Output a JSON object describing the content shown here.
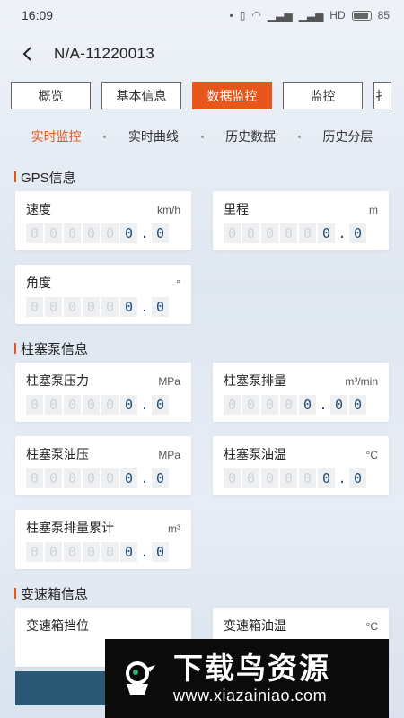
{
  "status_bar": {
    "time": "16:09",
    "network": "HD",
    "battery": "85"
  },
  "header": {
    "title": "N/A-11220013"
  },
  "tabs": [
    {
      "label": "概览",
      "active": false
    },
    {
      "label": "基本信息",
      "active": false
    },
    {
      "label": "数据监控",
      "active": true
    },
    {
      "label": "监控",
      "active": false
    },
    {
      "label": "扌",
      "active": false
    }
  ],
  "subtabs": [
    {
      "label": "实时监控",
      "active": true
    },
    {
      "label": "实时曲线",
      "active": false
    },
    {
      "label": "历史数据",
      "active": false
    },
    {
      "label": "历史分层",
      "active": false
    }
  ],
  "sections": {
    "gps": {
      "title": "GPS信息",
      "speed": {
        "label": "速度",
        "unit": "km/h",
        "value": "0.0"
      },
      "mileage": {
        "label": "里程",
        "unit": "m",
        "value": "0.0"
      },
      "angle": {
        "label": "角度",
        "unit": "°",
        "value": "0.0"
      }
    },
    "pump": {
      "title": "柱塞泵信息",
      "pressure": {
        "label": "柱塞泵压力",
        "unit": "MPa",
        "value": "0.0"
      },
      "displacement": {
        "label": "柱塞泵排量",
        "unit": "m³/min",
        "value": "0.00"
      },
      "oil_pressure": {
        "label": "柱塞泵油压",
        "unit": "MPa",
        "value": "0.0"
      },
      "oil_temp": {
        "label": "柱塞泵油温",
        "unit": "°C",
        "value": "0.0"
      },
      "total_displacement": {
        "label": "柱塞泵排量累计",
        "unit": "m³",
        "value": "0.0"
      }
    },
    "gearbox": {
      "title": "变速箱信息",
      "gear": {
        "label": "变速箱挡位"
      },
      "oil_temp": {
        "label": "变速箱油温",
        "unit": "°C"
      }
    }
  },
  "digit_placeholder": "0",
  "watermark": {
    "main": "下载鸟资源",
    "url": "www.xiazainiao.com"
  },
  "colors": {
    "accent": "#e8561b",
    "digit_on": "#1e4a73",
    "bottom_bar": "#2a5875"
  }
}
